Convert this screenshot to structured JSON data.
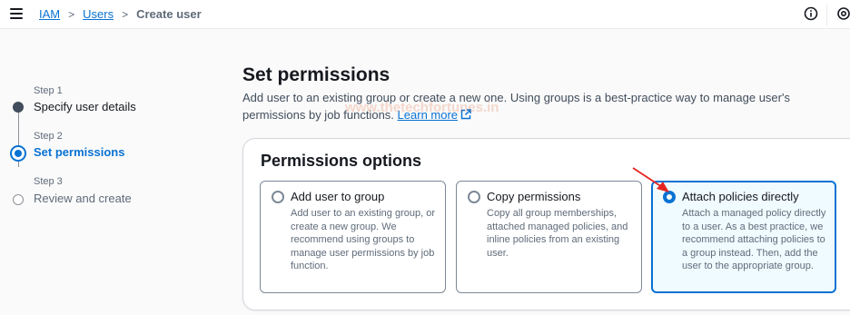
{
  "breadcrumb": {
    "items": [
      "IAM",
      "Users"
    ],
    "current": "Create user"
  },
  "wizard": {
    "steps": [
      {
        "number": "Step 1",
        "title": "Specify user details",
        "state": "completed"
      },
      {
        "number": "Step 2",
        "title": "Set permissions",
        "state": "current"
      },
      {
        "number": "Step 3",
        "title": "Review and create",
        "state": "upcoming"
      }
    ]
  },
  "main": {
    "title": "Set permissions",
    "description": "Add user to an existing group or create a new one. Using groups is a best-practice way to manage user's permissions by job functions.",
    "learn_more": "Learn more",
    "watermark": "www.thetechfortunes.in"
  },
  "permissions": {
    "title": "Permissions options",
    "options": [
      {
        "title": "Add user to group",
        "description": "Add user to an existing group, or create a new group. We recommend using groups to manage user permissions by job function.",
        "selected": false
      },
      {
        "title": "Copy permissions",
        "description": "Copy all group memberships, attached managed policies, and inline policies from an existing user.",
        "selected": false
      },
      {
        "title": "Attach policies directly",
        "description": "Attach a managed policy directly to a user. As a best practice, we recommend attaching policies to a group instead. Then, add the user to the appropriate group.",
        "selected": true
      }
    ]
  },
  "colors": {
    "accent": "#0972d3",
    "annotation_arrow": "#e52421",
    "selected_tile_bg": "#f0fbff"
  },
  "icons": [
    "menu-icon",
    "info-icon",
    "settings-icon",
    "external-link-icon",
    "chevron-right-icon"
  ]
}
